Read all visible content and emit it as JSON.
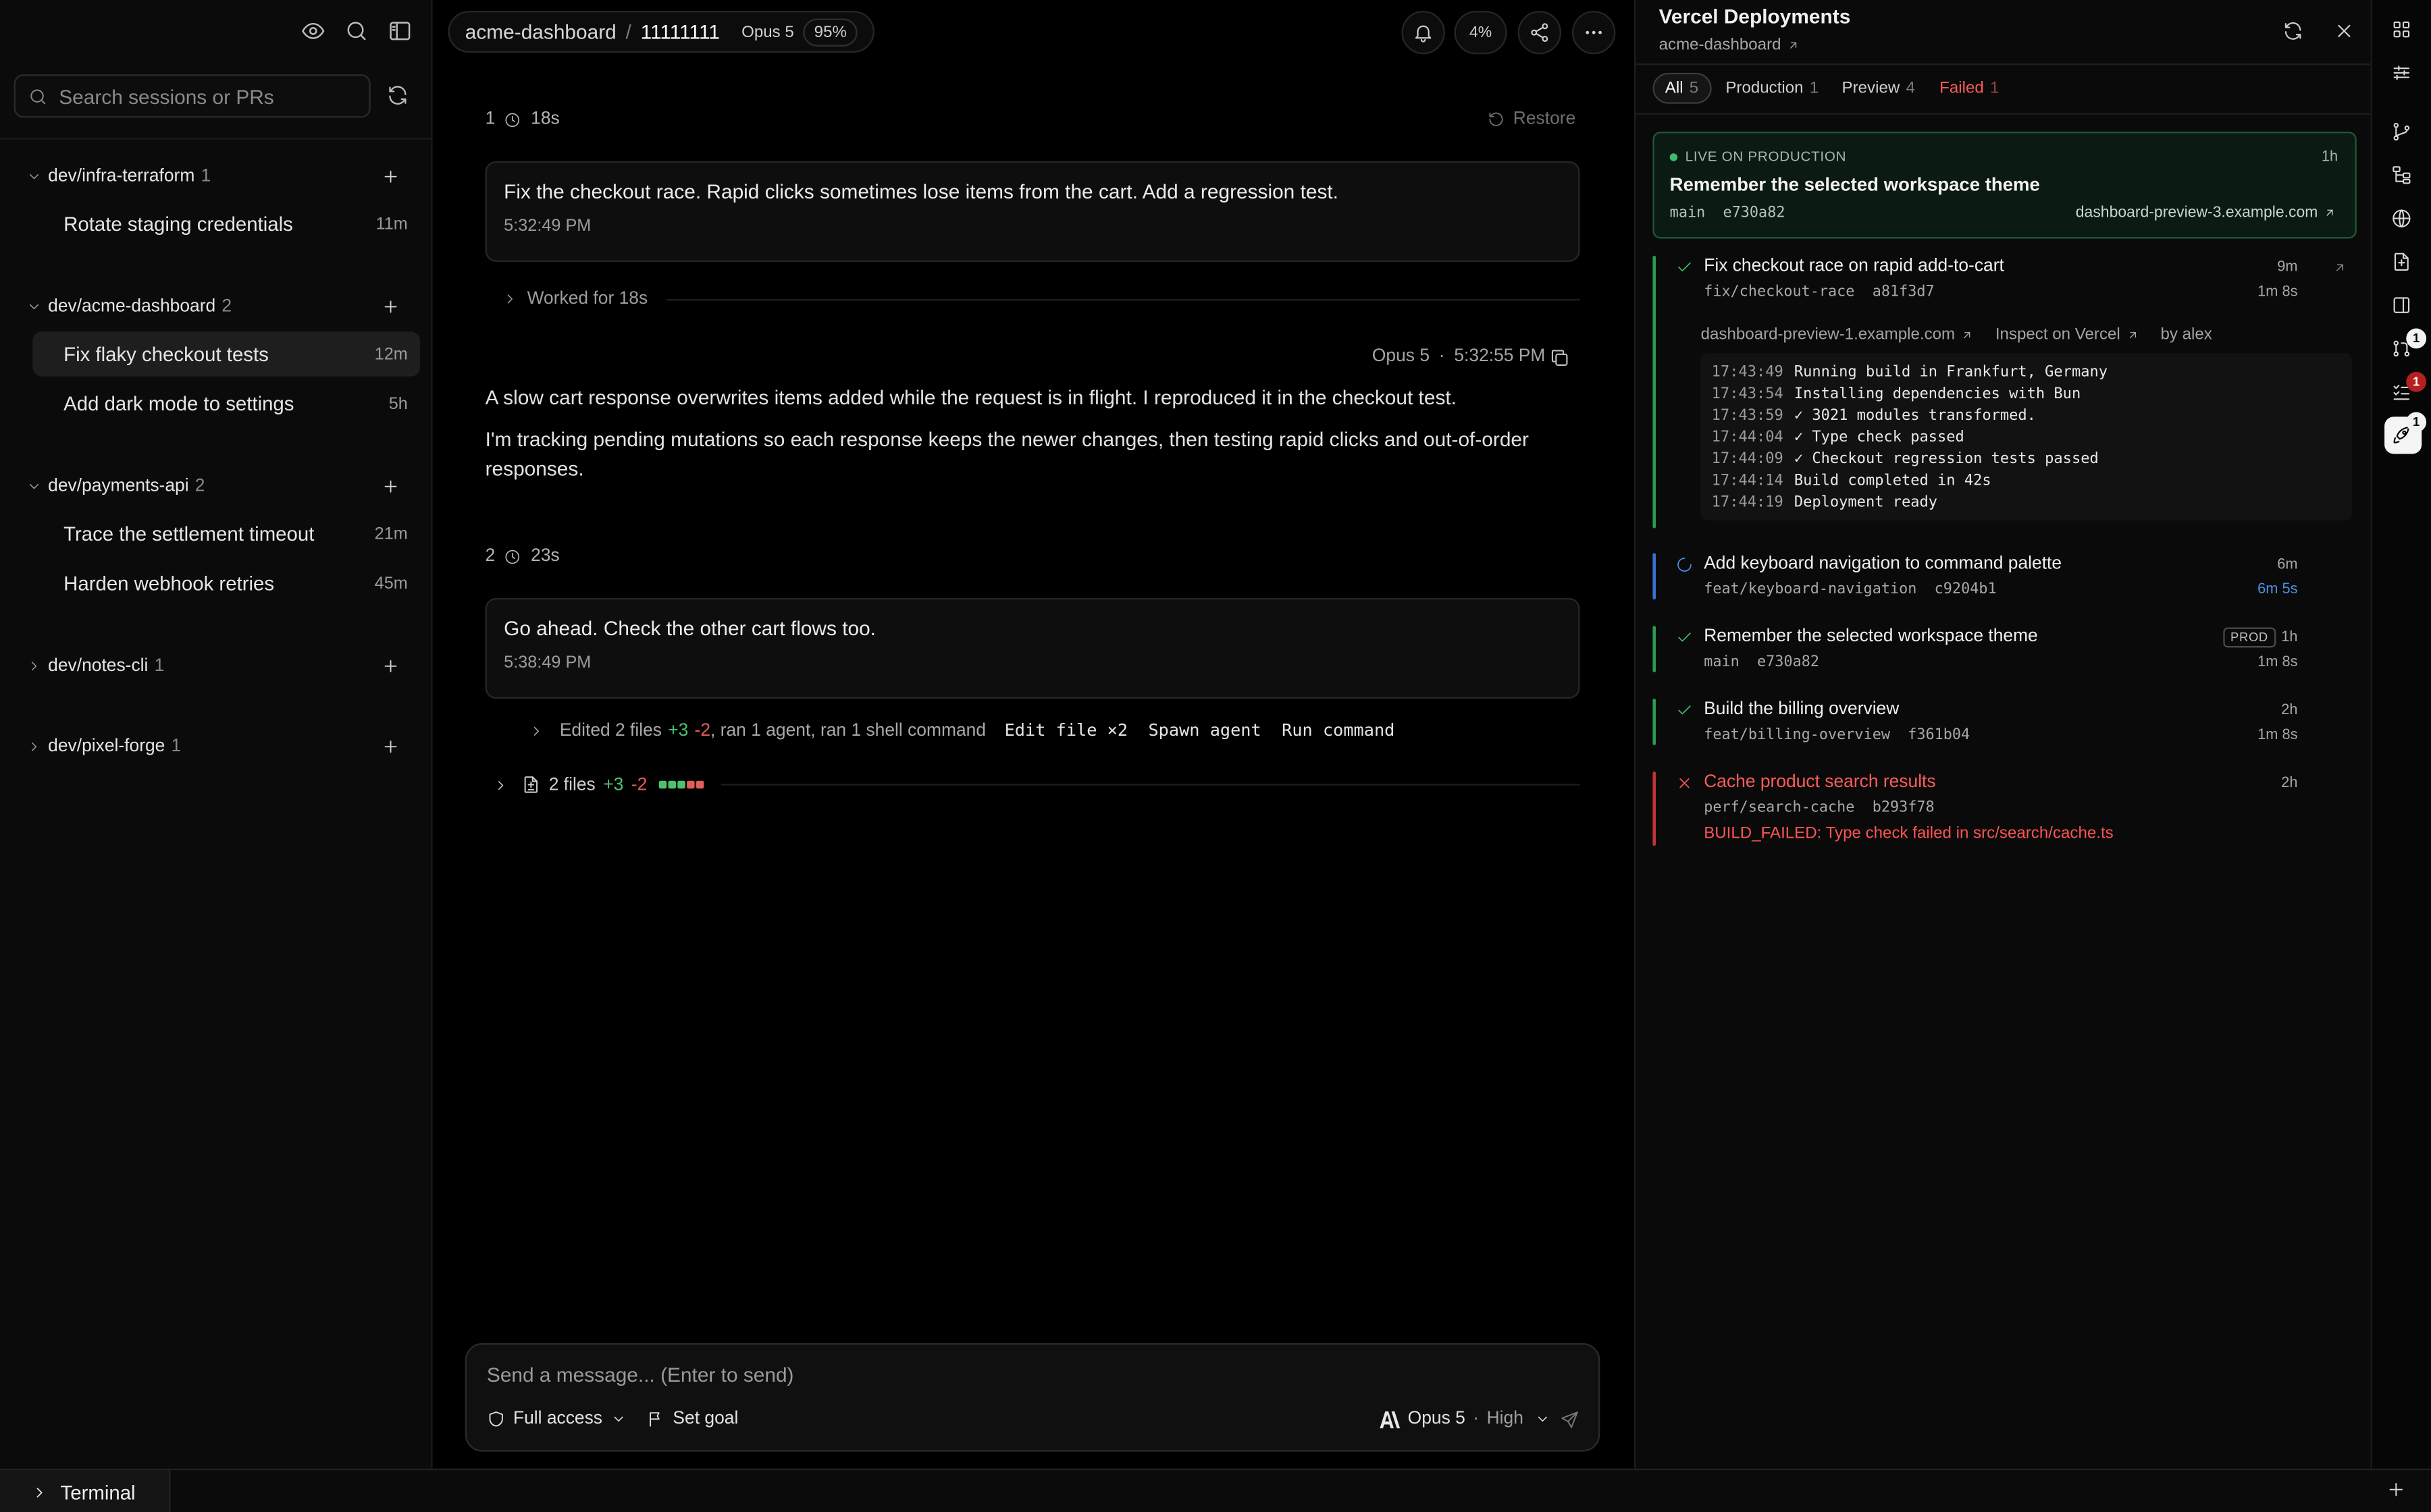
{
  "sidebar": {
    "search_placeholder": "Search sessions or PRs",
    "groups": [
      {
        "name": "dev/infra-terraform",
        "count": "1",
        "expanded": true,
        "sessions": [
          {
            "label": "Rotate staging credentials",
            "time": "11m"
          }
        ]
      },
      {
        "name": "dev/acme-dashboard",
        "count": "2",
        "expanded": true,
        "sessions": [
          {
            "label": "Fix flaky checkout tests",
            "time": "12m",
            "active": true
          },
          {
            "label": "Add dark mode to settings",
            "time": "5h"
          }
        ]
      },
      {
        "name": "dev/payments-api",
        "count": "2",
        "expanded": true,
        "sessions": [
          {
            "label": "Trace the settlement timeout",
            "time": "21m"
          },
          {
            "label": "Harden webhook retries",
            "time": "45m"
          }
        ]
      },
      {
        "name": "dev/notes-cli",
        "count": "1",
        "expanded": false,
        "sessions": []
      },
      {
        "name": "dev/pixel-forge",
        "count": "1",
        "expanded": false,
        "sessions": []
      }
    ]
  },
  "header": {
    "repo": "acme-dashboard",
    "separator": "/",
    "session_id": "11111111",
    "model": "Opus 5",
    "context": "95%",
    "usage": "4%"
  },
  "chat": {
    "turn1": {
      "index": "1",
      "duration": "18s",
      "restore_label": "Restore",
      "user_message": "Fix the checkout race. Rapid clicks sometimes lose items from the cart. Add a regression test.",
      "user_time": "5:32:49 PM",
      "worked_label": "Worked for 18s",
      "reply_model": "Opus 5",
      "reply_dot": "·",
      "reply_time": "5:32:55 PM",
      "reply_p1": "A slow cart response overwrites items added while the request is in flight. I reproduced it in the checkout test.",
      "reply_p2": "I'm tracking pending mutations so each response keeps the newer changes, then testing rapid clicks and out-of-order responses."
    },
    "turn2": {
      "index": "2",
      "duration": "23s",
      "user_message": "Go ahead. Check the other cart flows too.",
      "user_time": "5:38:49 PM",
      "edited_prefix": "Edited 2 files",
      "edited_add": "+3",
      "edited_del": "-2",
      "edited_suffix": ", ran 1 agent, ran 1 shell command",
      "tools": "Edit file ×2  Spawn agent  Run command",
      "files_label": "2 files",
      "files_add": "+3",
      "files_del": "-2"
    }
  },
  "composer": {
    "placeholder": "Send a message... (Enter to send)",
    "access": "Full access",
    "goal": "Set goal",
    "model": "Opus 5",
    "effort_sep": "·",
    "effort": "High"
  },
  "deployments": {
    "title": "Vercel Deployments",
    "project": "acme-dashboard",
    "filters": [
      {
        "label": "All",
        "count": "5",
        "active": true
      },
      {
        "label": "Production",
        "count": "1"
      },
      {
        "label": "Preview",
        "count": "4"
      },
      {
        "label": "Failed",
        "count": "1",
        "failed": true
      }
    ],
    "live": {
      "label": "LIVE ON PRODUCTION",
      "age": "1h",
      "title": "Remember the selected workspace theme",
      "branch": "main",
      "commit": "e730a82",
      "url": "dashboard-preview-3.example.com"
    },
    "items": [
      {
        "title": "Fix checkout race on rapid add-to-cart",
        "branch": "fix/checkout-race",
        "commit": "a81f3d7",
        "age": "9m",
        "duration": "1m 8s",
        "status": "ready",
        "preview_url": "dashboard-preview-1.example.com",
        "inspect": "Inspect on Vercel",
        "author": "by alex",
        "log": [
          {
            "t": "17:43:49",
            "m": "Running build in Frankfurt, Germany"
          },
          {
            "t": "17:43:54",
            "m": "Installing dependencies with Bun"
          },
          {
            "t": "17:43:59",
            "m": "✓ 3021 modules transformed."
          },
          {
            "t": "17:44:04",
            "m": "✓ Type check passed"
          },
          {
            "t": "17:44:09",
            "m": "✓ Checkout regression tests passed"
          },
          {
            "t": "17:44:14",
            "m": "Build completed in 42s"
          },
          {
            "t": "17:44:19",
            "m": "Deployment ready"
          }
        ]
      },
      {
        "title": "Add keyboard navigation to command palette",
        "branch": "feat/keyboard-navigation",
        "commit": "c9204b1",
        "age": "6m",
        "duration": "6m 5s",
        "status": "building"
      },
      {
        "title": "Remember the selected workspace theme",
        "branch": "main",
        "commit": "e730a82",
        "age": "1h",
        "duration": "1m 8s",
        "status": "ready",
        "badge": "PROD"
      },
      {
        "title": "Build the billing overview",
        "branch": "feat/billing-overview",
        "commit": "f361b04",
        "age": "2h",
        "duration": "1m 8s",
        "status": "ready"
      },
      {
        "title": "Cache product search results",
        "branch": "perf/search-cache",
        "commit": "b293f78",
        "age": "2h",
        "status": "failed",
        "error": "BUILD_FAILED: Type check failed in src/search/cache.ts"
      }
    ]
  },
  "rail": {
    "badge_top": "1",
    "badge_mid": "1",
    "badge_active": "1"
  },
  "terminal": {
    "label": "Terminal"
  },
  "colors": {
    "success": "#3fbd6c",
    "failure": "#ff5454",
    "building": "#4e8fe8",
    "diff_add": "#4fc16e",
    "diff_del": "#e35d5d"
  }
}
